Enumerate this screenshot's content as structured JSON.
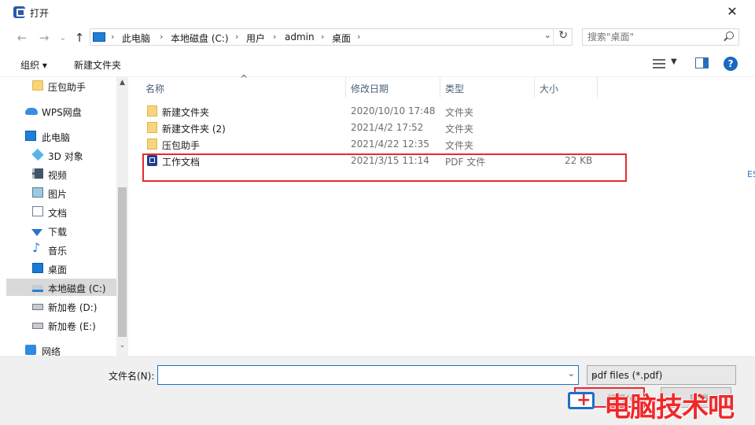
{
  "window": {
    "title": "打开",
    "close_glyph": "✕"
  },
  "nav": {
    "back_glyph": "←",
    "forward_glyph": "→",
    "recent_glyph": "⌄",
    "up_glyph": "↑",
    "breadcrumbs": [
      "此电脑",
      "本地磁盘 (C:)",
      "用户",
      "admin",
      "桌面"
    ],
    "separator": "›",
    "dropdown_glyph": "⌄",
    "refresh_glyph": "↻",
    "search_placeholder": "搜索\"桌面\""
  },
  "toolbar": {
    "organize_label": "组织 ▾",
    "new_folder_label": "新建文件夹",
    "view_drop_glyph": "▼",
    "help_glyph": "?"
  },
  "sidebar": {
    "items": [
      {
        "label": "压包助手",
        "icon": "folder-icon"
      },
      {
        "label": "WPS网盘",
        "icon": "cloud-icon"
      },
      {
        "label": "此电脑",
        "icon": "computer-icon"
      },
      {
        "label": "3D 对象",
        "icon": "cube-icon"
      },
      {
        "label": "视频",
        "icon": "video-icon"
      },
      {
        "label": "图片",
        "icon": "picture-icon"
      },
      {
        "label": "文档",
        "icon": "document-icon"
      },
      {
        "label": "下载",
        "icon": "download-icon"
      },
      {
        "label": "音乐",
        "icon": "music-icon"
      },
      {
        "label": "桌面",
        "icon": "desktop-icon"
      },
      {
        "label": "本地磁盘 (C:)",
        "icon": "drive-icon",
        "selected": true
      },
      {
        "label": "新加卷 (D:)",
        "icon": "drive-icon"
      },
      {
        "label": "新加卷 (E:)",
        "icon": "drive-icon"
      },
      {
        "label": "网络",
        "icon": "network-icon"
      }
    ],
    "scroll_up": "▲",
    "scroll_down": "⌄"
  },
  "filelist": {
    "columns": {
      "name": "名称",
      "modified": "修改日期",
      "type": "类型",
      "size": "大小"
    },
    "sort_glyph": "^",
    "rows": [
      {
        "name": "新建文件夹",
        "modified": "2020/10/10 17:48",
        "type": "文件夹",
        "size": "",
        "icon": "folder-icon"
      },
      {
        "name": "新建文件夹 (2)",
        "modified": "2021/4/2 17:52",
        "type": "文件夹",
        "size": "",
        "icon": "folder-icon"
      },
      {
        "name": "压包助手",
        "modified": "2021/4/22 12:35",
        "type": "文件夹",
        "size": "",
        "icon": "folder-icon"
      },
      {
        "name": "工作文档",
        "modified": "2021/3/15 11:14",
        "type": "PDF 文件",
        "size": "22 KB",
        "icon": "pdf-icon"
      }
    ]
  },
  "footer": {
    "filename_label": "文件名(N):",
    "filename_value": "",
    "filename_drop": "⌄",
    "filetype_value": "pdf files (*.pdf)",
    "filetype_drop": "⌄",
    "open_label": "打开(O)",
    "cancel_label": "取消"
  },
  "watermark": {
    "text": "电脑技术吧",
    "icon_glyph": "+"
  },
  "edge_fragment": "ES",
  "colors": {
    "accent": "#1e6fc9",
    "highlight": "#e8292f",
    "folder": "#f7d57c"
  }
}
